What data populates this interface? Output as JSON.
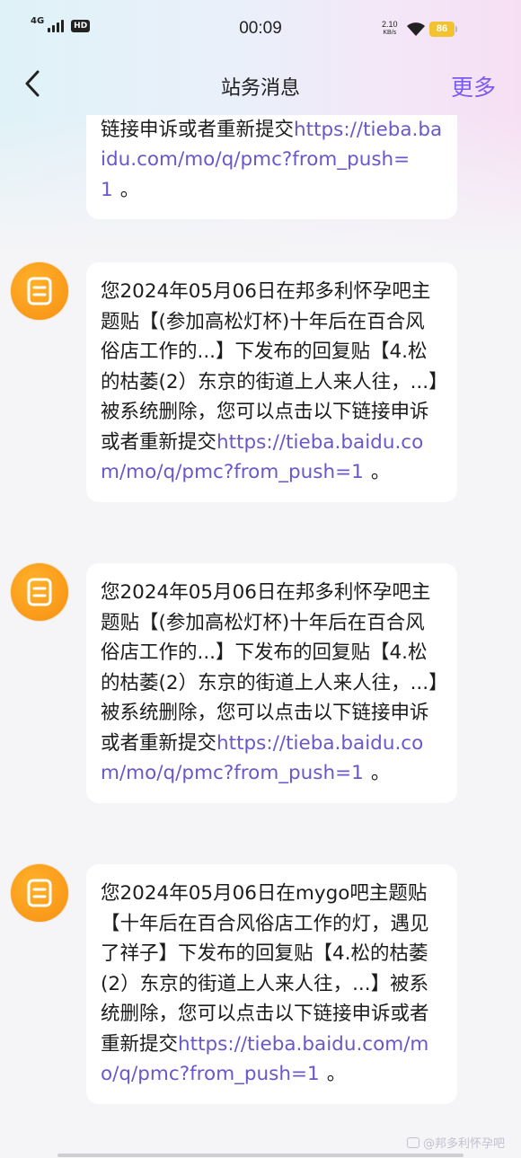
{
  "status_bar": {
    "network": "4G",
    "hd": "HD",
    "time": "00:09",
    "speed_value": "2.10",
    "speed_unit": "KB/s",
    "battery": "86"
  },
  "nav": {
    "back_icon": "chevron-left-icon",
    "title": "站务消息",
    "more": "更多"
  },
  "colors": {
    "accent": "#7b5cf0",
    "link": "#6a58c9",
    "avatar": "#fb9d1c",
    "battery": "#f2c230"
  },
  "messages": [
    {
      "text": "往，...】被系统删除，您可以点击以下链接申诉或者重新提交",
      "link": "https://tieba.baidu.com/mo/q/pmc?from_push=1",
      "end": "。"
    },
    {
      "text": "您2024年05月06日在邦多利怀孕吧主题贴【(参加高松灯杯)十年后在百合风俗店工作的...】下发布的回复贴【4.松的枯萎(2）东京的街道上人来人往，...】被系统删除，您可以点击以下链接申诉或者重新提交",
      "link": "https://tieba.baidu.com/mo/q/pmc?from_push=1",
      "end": "。"
    },
    {
      "text": "您2024年05月06日在邦多利怀孕吧主题贴【(参加高松灯杯)十年后在百合风俗店工作的...】下发布的回复贴【4.松的枯萎(2）东京的街道上人来人往，...】被系统删除，您可以点击以下链接申诉或者重新提交",
      "link": "https://tieba.baidu.com/mo/q/pmc?from_push=1",
      "end": "。"
    },
    {
      "text": "您2024年05月06日在mygo吧主题贴【十年后在百合风俗店工作的灯，遇见了祥子】下发布的回复贴【4.松的枯萎(2）东京的街道上人来人往，...】被系统删除，您可以点击以下链接申诉或者重新提交",
      "link": "https://tieba.baidu.com/mo/q/pmc?from_push=1",
      "end": "。"
    }
  ],
  "watermark": "@邦多利怀孕吧"
}
